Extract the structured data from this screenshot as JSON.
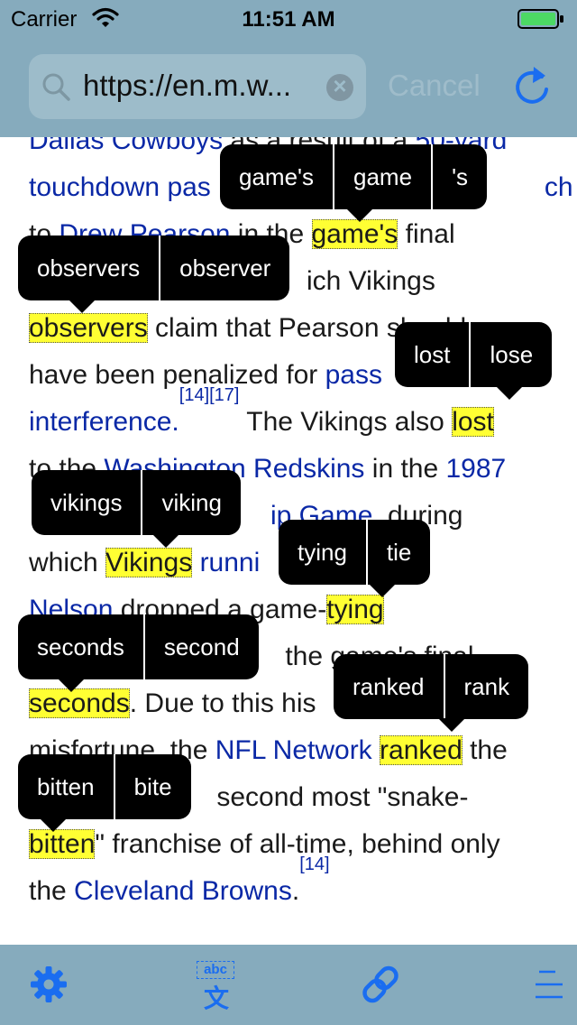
{
  "status_bar": {
    "carrier": "Carrier",
    "time": "11:51 AM"
  },
  "navbar": {
    "search_value": "https://en.m.w...",
    "cancel_label": "Cancel"
  },
  "colors": {
    "bar": "#86abbd",
    "highlight": "#ffff33",
    "link": "#0a28a6",
    "accent": "#1a6df0"
  },
  "article": {
    "l0": [
      "Dallas Cowboys",
      " as a result of a ",
      "50-yard"
    ],
    "l1": [
      "touchdown pas",
      "ch"
    ],
    "l2": [
      "to ",
      "Drew Pearson",
      " in the ",
      "game's",
      " final"
    ],
    "l3": [
      "ich Vikings"
    ],
    "l4": [
      "observers",
      " claim that Pearson should"
    ],
    "l5": [
      "have been penalized for ",
      "pass"
    ],
    "l6": [
      "interference.",
      "[14][17]",
      " The Vikings also ",
      "lost"
    ],
    "l7": [
      "to the ",
      "Washington Redskins",
      " in the ",
      "1987"
    ],
    "l8": [
      "ip Game",
      ", during"
    ],
    "l9": [
      "which ",
      "Vikings",
      " ",
      "runni",
      "rin"
    ],
    "l10": [
      "Nelson",
      " dropped a game-",
      "tying"
    ],
    "l11": [
      " the game's final"
    ],
    "l12": [
      "seconds",
      ". Due to this his"
    ],
    "l13": [
      "misfortune, the ",
      "NFL Network",
      " ",
      "ranked",
      " the"
    ],
    "l14": [
      " second most \"snake-"
    ],
    "l15": [
      "bitten",
      "\" franchise of all-time, behind only"
    ],
    "l16": [
      "the ",
      "Cleveland Browns",
      ".",
      "[14]"
    ]
  },
  "popups": [
    {
      "surface": "game's",
      "lemma": "game",
      "suffix": "'s"
    },
    {
      "surface": "observers",
      "lemma": "observer"
    },
    {
      "surface": "lost",
      "lemma": "lose"
    },
    {
      "surface": "vikings",
      "lemma": "viking"
    },
    {
      "surface": "tying",
      "lemma": "tie"
    },
    {
      "surface": "seconds",
      "lemma": "second"
    },
    {
      "surface": "ranked",
      "lemma": "rank"
    },
    {
      "surface": "bitten",
      "lemma": "bite"
    }
  ],
  "toolbar": {
    "icons": [
      "gear-icon",
      "translate-icon",
      "link-icon",
      "menu-icon"
    ],
    "translate_badge": "abc",
    "translate_glyph": "文"
  }
}
